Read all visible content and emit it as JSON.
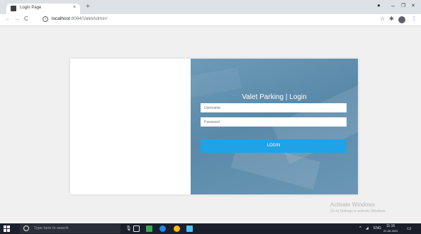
{
  "browser": {
    "tab_title": "Login Page",
    "tab_close": "×",
    "new_tab": "+",
    "url_host": "localhost",
    "url_path": ":8084/ValetAdmin/",
    "back": "←",
    "forward": "→",
    "reload": "C",
    "star": "☆",
    "extension": "✱",
    "menu": "⋮",
    "minimize": "–",
    "restore": "❐",
    "close": "✕"
  },
  "login": {
    "title": "Valet Parking | Login",
    "username_placeholder": "Username",
    "password_placeholder": "Password",
    "button_label": "LOGIN"
  },
  "watermark": {
    "title": "Activate Windows",
    "subtitle": "Go to Settings to activate Windows."
  },
  "taskbar": {
    "search_placeholder": "Type here to search",
    "language": "ENG",
    "time": "11:16",
    "date": "22-06-2022"
  },
  "colors": {
    "login_panel": "#5f8fb0",
    "login_button": "#1fa3e6",
    "taskbar": "#1a1f2b"
  }
}
